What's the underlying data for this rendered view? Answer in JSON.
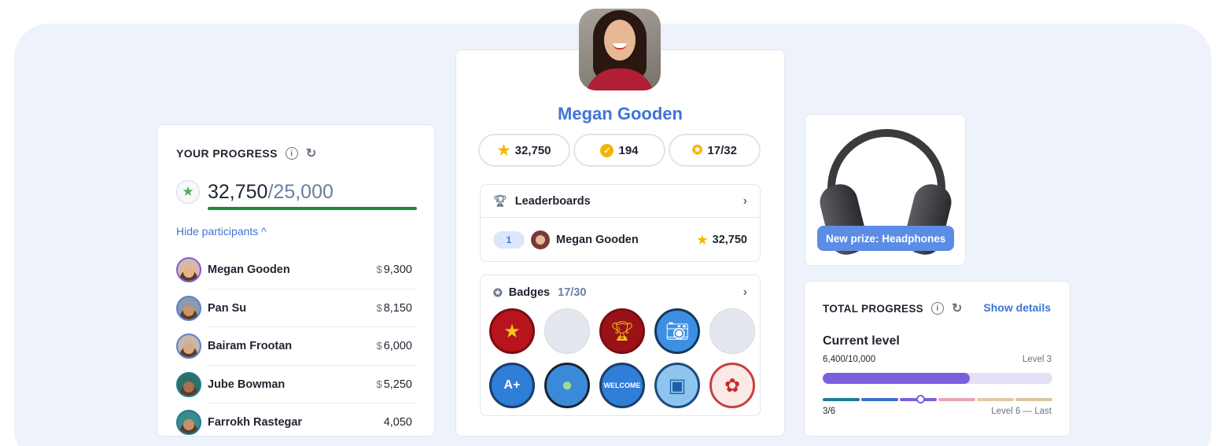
{
  "your_progress": {
    "title": "YOUR PROGRESS",
    "score": "32,750",
    "goal": "/25,000",
    "hide_link": "Hide participants ^",
    "participants": [
      {
        "name": "Megan Gooden",
        "currency": "$",
        "value": "9,300"
      },
      {
        "name": "Pan Su",
        "currency": "$",
        "value": "8,150"
      },
      {
        "name": "Bairam Frootan",
        "currency": "$",
        "value": "6,000"
      },
      {
        "name": "Jube Bowman",
        "currency": "$",
        "value": "5,250"
      },
      {
        "name": "Farrokh Rastegar",
        "currency": "",
        "value": "4,050"
      }
    ]
  },
  "profile": {
    "name": "Megan Gooden",
    "stats": {
      "points": "32,750",
      "coins": "194",
      "badges": "17/32"
    },
    "leaderboards": {
      "title": "Leaderboards",
      "entry": {
        "rank": "1",
        "name": "Megan Gooden",
        "score": "32,750"
      }
    },
    "badges": {
      "title": "Badges",
      "count": "17/30",
      "items": [
        "stars-badge",
        "empty",
        "trophy-badge",
        "camera-badge",
        "empty",
        "grade-badge",
        "traffic-light-badge",
        "welcome-badge",
        "briefcase-badge",
        "flower-badge"
      ]
    }
  },
  "prize": {
    "label": "New prize: Headphones"
  },
  "total_progress": {
    "title": "TOTAL PROGRESS",
    "show_details": "Show details",
    "current_level": "Current level",
    "level_numbers": "6,400/10,000",
    "level_name": "Level 3",
    "level_fill": 0.64,
    "steps": "3/6",
    "last_level": "Level 6 — Last",
    "segment_colors": [
      "#1d7d94",
      "#3b6fd1",
      "#7b5ee0",
      "#e8a5ad",
      "#e2c9a3",
      "#d8c89b"
    ]
  },
  "colors": {
    "accent": "#3f73d8",
    "bg": "#eef2fb",
    "progress_green": "#1a8a36"
  }
}
